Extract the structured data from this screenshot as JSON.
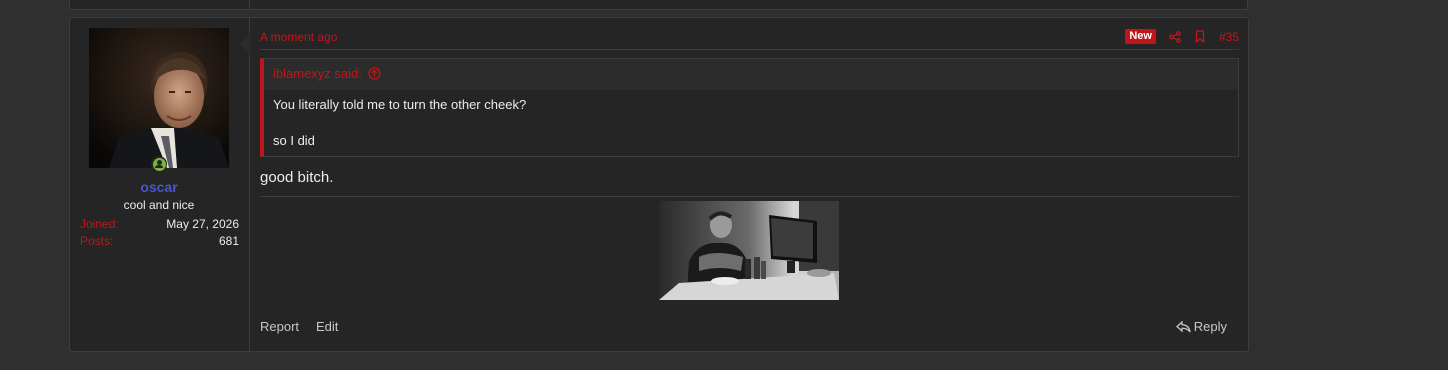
{
  "post": {
    "user": {
      "name": "oscar",
      "title": "cool and nice",
      "online_icon": "user-online-icon",
      "stats": [
        {
          "label": "Joined:",
          "value": "May 27, 2026"
        },
        {
          "label": "Posts:",
          "value": "681"
        }
      ]
    },
    "time": "A moment ago",
    "badge_new": "New",
    "post_number": "#35",
    "quote": {
      "author_said": "iblamexyz said:",
      "lines": [
        "You literally told me to turn the other cheek?",
        "so I did"
      ]
    },
    "message": "good bitch.",
    "footer": {
      "report": "Report",
      "edit": "Edit",
      "reply": "Reply"
    }
  },
  "colors": {
    "accent": "#c0161b",
    "username": "#4b55cc",
    "online": "#7cb342",
    "background": "#2f2f2f",
    "panel": "#252525"
  }
}
